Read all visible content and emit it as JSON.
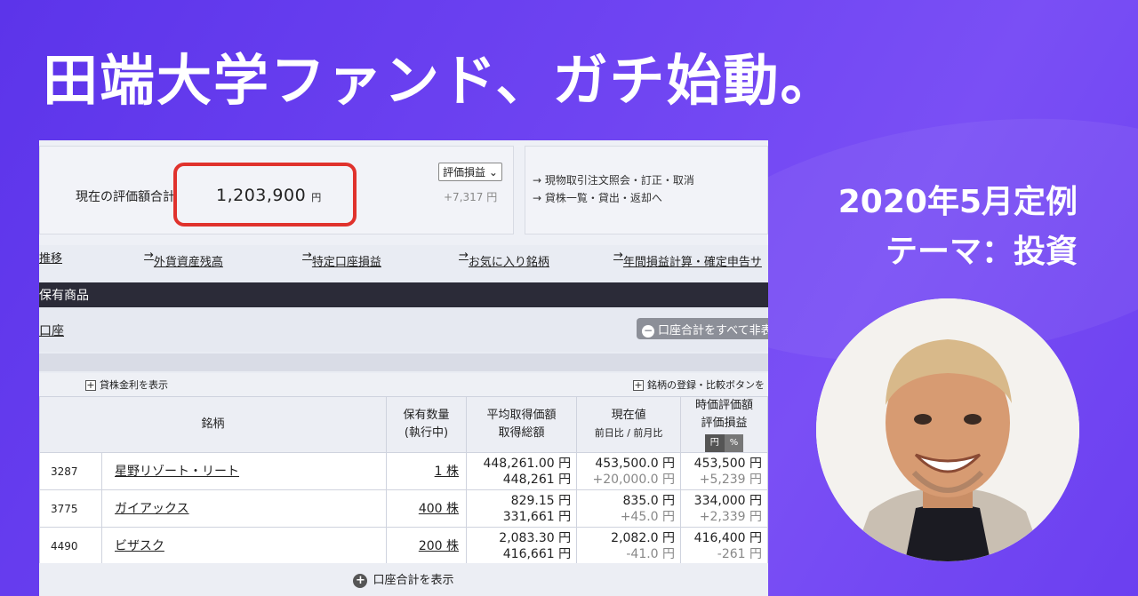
{
  "banner": {
    "title": "田端大学ファンド、ガチ始動。",
    "date_line": "2020年5月定例",
    "theme_line": "テーマ：投資"
  },
  "summary": {
    "label": "現在の評価額合計",
    "value": "1,203,900",
    "unit": "円",
    "select": "評価損益",
    "diff": "+7,317 円",
    "links": [
      "現物取引注文照会・訂正・取消",
      "貸株一覧・貸出・返却へ"
    ]
  },
  "nav_links": [
    "推移",
    "外貨資産残高",
    "特定口座損益",
    "お気に入り銘柄",
    "年間損益計算・確定申告サ"
  ],
  "section_title": "保有商品",
  "account_link": "口座",
  "account_button": "口座合計をすべて非表",
  "toggles": {
    "lending": "貸株金利を表示",
    "compare": "銘柄の登録・比較ボタンを"
  },
  "table": {
    "headers": {
      "name": "銘柄",
      "qty": "保有数量",
      "qty_sub": "(執行中)",
      "avg": "平均取得価額",
      "avg_sub": "取得総額",
      "price": "現在値",
      "price_sub": "前日比 / 前月比",
      "value": "時価評価額",
      "value_sub": "評価損益",
      "pill_yen": "円",
      "pill_pct": "%"
    },
    "rows": [
      {
        "code": "3287",
        "name": "星野リゾート・リート",
        "qty": "1 株",
        "avg": "448,261.00 円",
        "total": "448,261 円",
        "price": "453,500.0 円",
        "change": "+20,000.0 円",
        "value": "453,500 円",
        "pl": "+5,239 円"
      },
      {
        "code": "3775",
        "name": "ガイアックス",
        "qty": "400 株",
        "avg": "829.15 円",
        "total": "331,661 円",
        "price": "835.0 円",
        "change": "+45.0 円",
        "value": "334,000 円",
        "pl": "+2,339 円"
      },
      {
        "code": "4490",
        "name": "ビザスク",
        "qty": "200 株",
        "avg": "2,083.30 円",
        "total": "416,661 円",
        "price": "2,082.0 円",
        "change": "-41.0 円",
        "value": "416,400 円",
        "pl": "-261 円"
      }
    ]
  },
  "footer_button": "口座合計を表示"
}
